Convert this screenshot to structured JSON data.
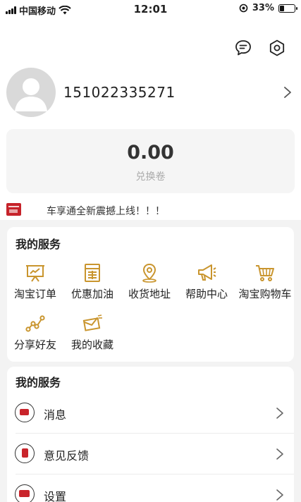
{
  "status_bar": {
    "carrier": "中国移动",
    "time": "12:01",
    "battery": "33%",
    "battery_level": 0.33
  },
  "header": {
    "message_icon": "chat-bubble-icon",
    "settings_icon": "settings-hexagon-icon"
  },
  "profile": {
    "phone": "151022335271"
  },
  "balance": {
    "value": "0.00",
    "label": "兑换卷"
  },
  "notice": {
    "text": "车享通全新震撼上线！！！"
  },
  "services": {
    "title": "我的服务",
    "items": [
      {
        "label": "淘宝订单",
        "icon": "presentation-chart-icon"
      },
      {
        "label": "优惠加油",
        "icon": "calculator-icon"
      },
      {
        "label": "收货地址",
        "icon": "map-pin-icon"
      },
      {
        "label": "帮助中心",
        "icon": "megaphone-icon"
      },
      {
        "label": "淘宝购物车",
        "icon": "shopping-cart-icon"
      },
      {
        "label": "分享好友",
        "icon": "share-graph-icon"
      },
      {
        "label": "我的收藏",
        "icon": "envelope-icon"
      }
    ],
    "accent": "#c9952e"
  },
  "menu": {
    "title": "我的服务",
    "items": [
      {
        "label": "消息",
        "icon": "message-icon"
      },
      {
        "label": "意见反馈",
        "icon": "feedback-icon"
      },
      {
        "label": "设置",
        "icon": "settings-icon"
      }
    ]
  },
  "colors": {
    "accent_gold": "#c9952e",
    "accent_red": "#c9242b"
  }
}
